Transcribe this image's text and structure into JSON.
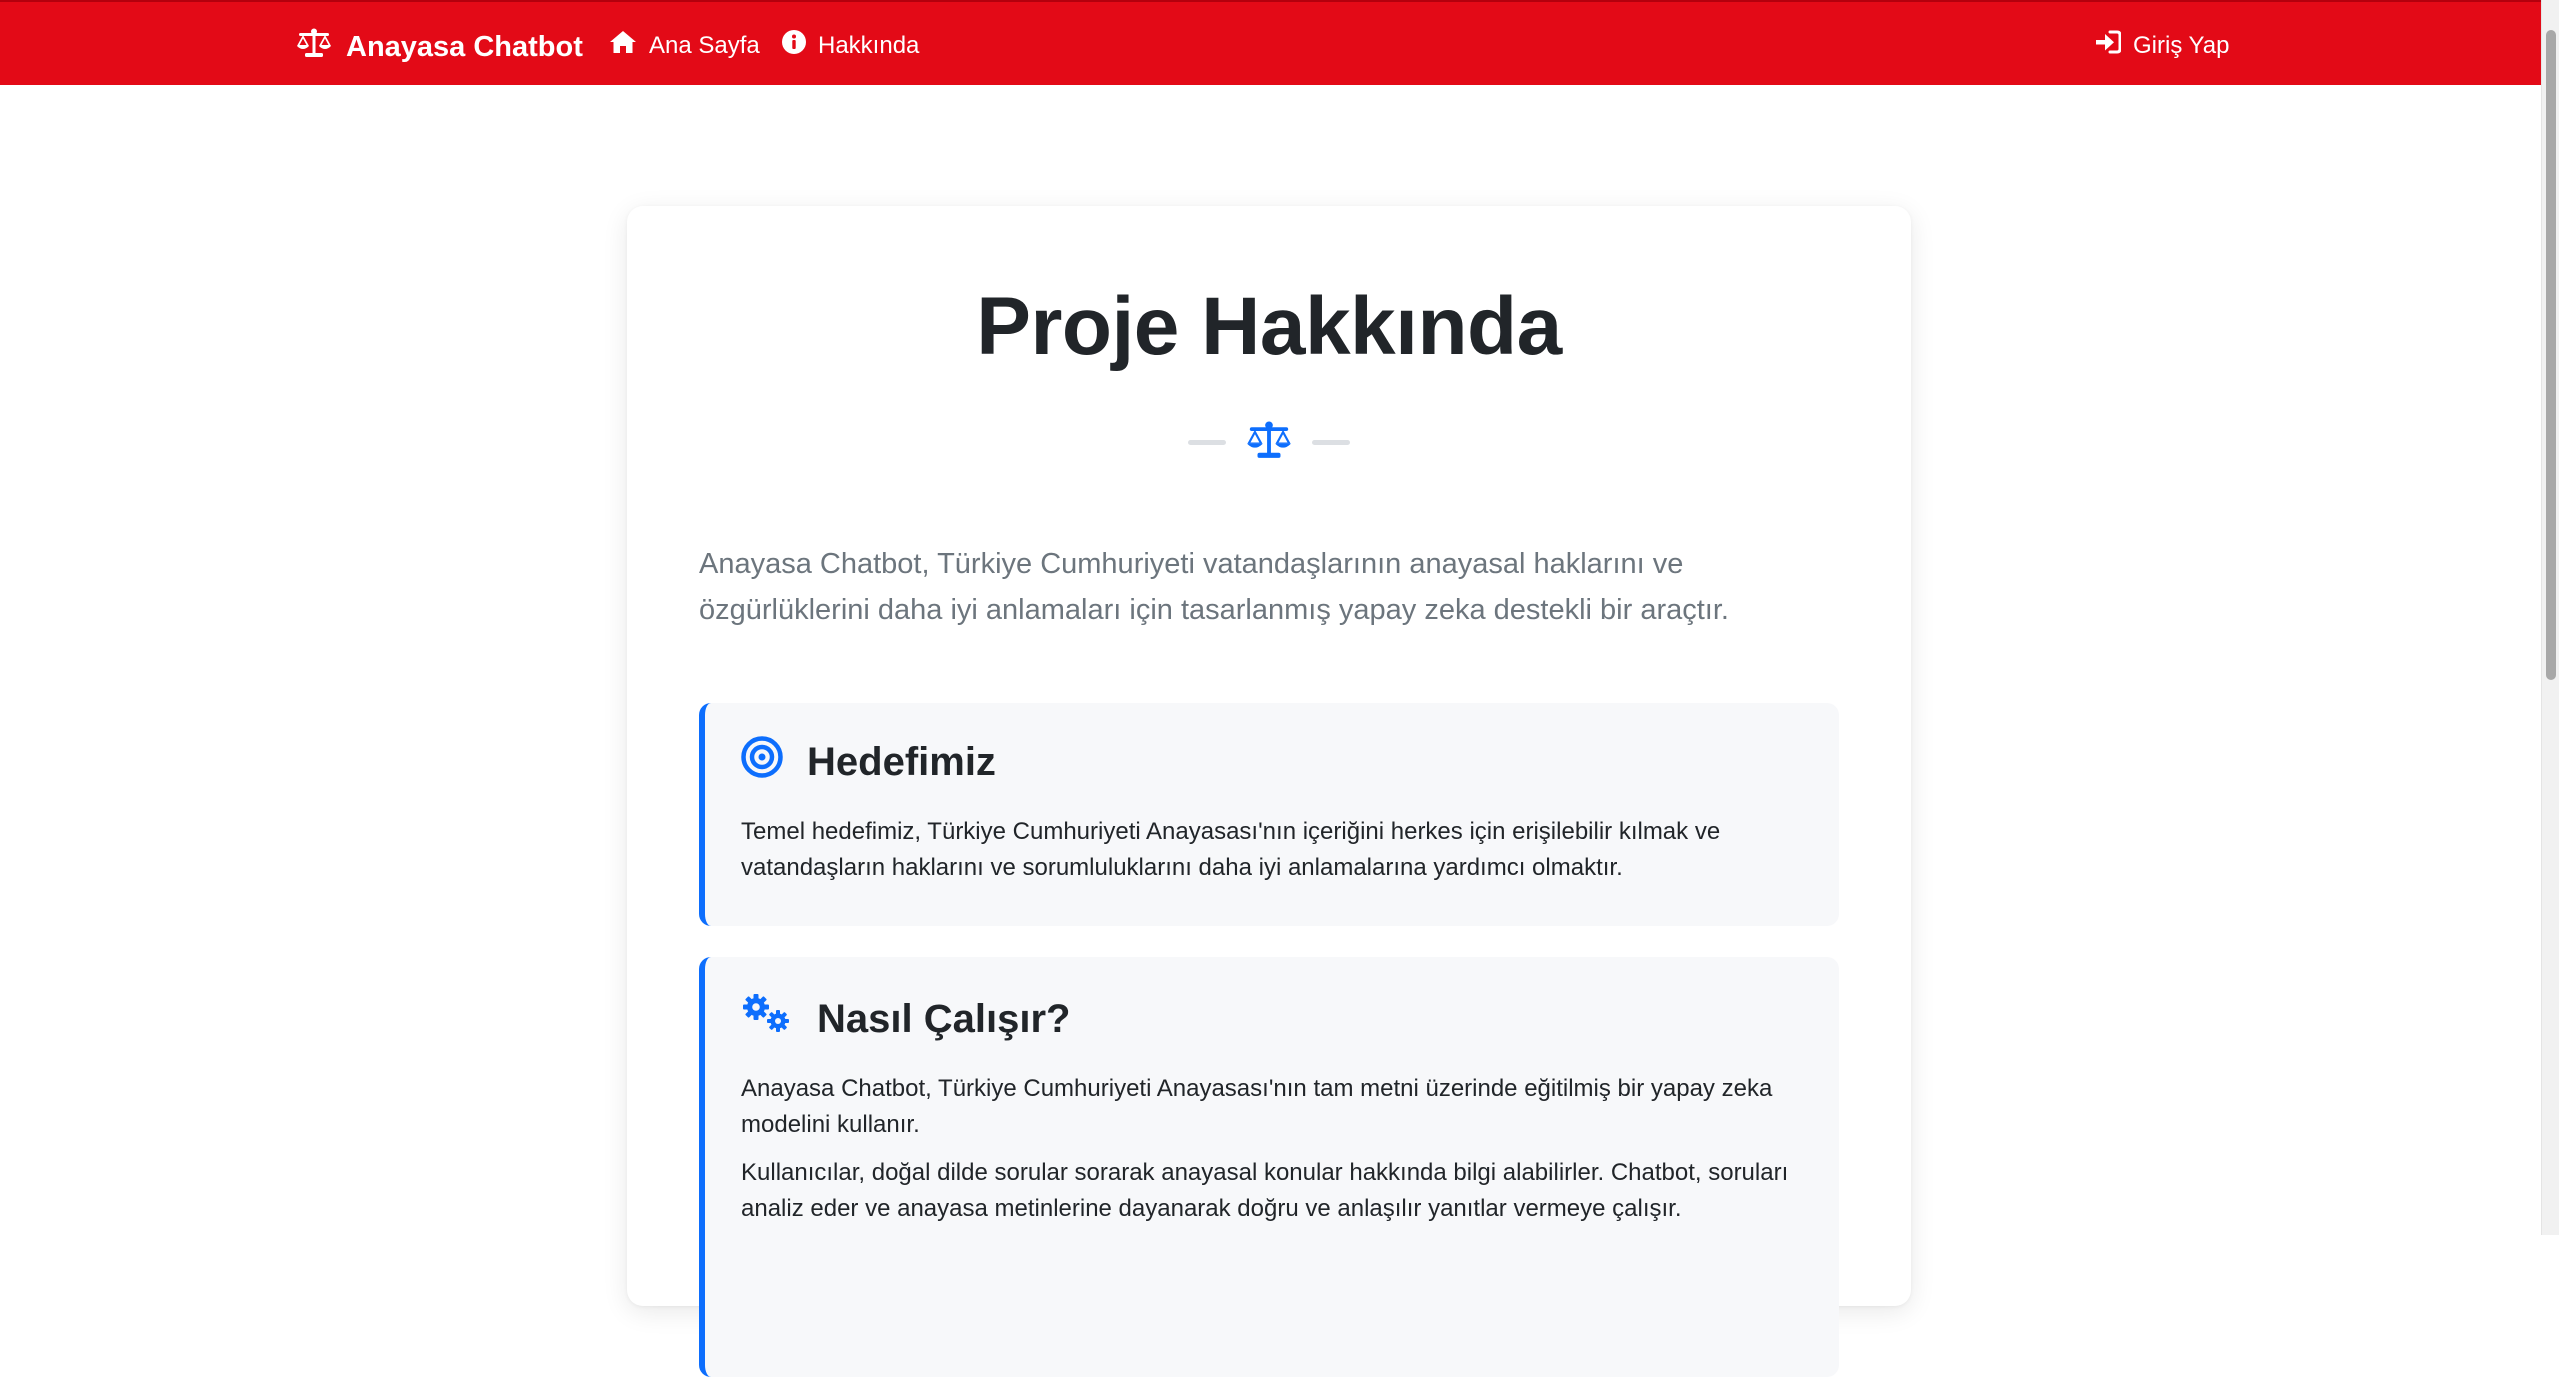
{
  "navbar": {
    "brand": "Anayasa Chatbot",
    "links": [
      {
        "label": "Ana Sayfa",
        "icon": "home-icon"
      },
      {
        "label": "Hakkında",
        "icon": "info-circle-icon"
      }
    ],
    "login": {
      "label": "Giriş Yap",
      "icon": "sign-in-icon"
    },
    "brand_color": "#e30a17"
  },
  "main": {
    "title": "Proje Hakkında",
    "divider_icon": "balance-scale-icon",
    "lead": "Anayasa Chatbot, Türkiye Cumhuriyeti vatandaşlarının anayasal haklarını ve özgürlüklerini daha iyi anlamaları için tasarlanmış yapay zeka destekli bir araçtır.",
    "accent_color": "#0d6efd",
    "sections": [
      {
        "icon": "bullseye-icon",
        "title": "Hedefimiz",
        "paragraphs": [
          "Temel hedefimiz, Türkiye Cumhuriyeti Anayasası'nın içeriğini herkes için erişilebilir kılmak ve vatandaşların haklarını ve sorumluluklarını daha iyi anlamalarına yardımcı olmaktır."
        ]
      },
      {
        "icon": "cogs-icon",
        "title": "Nasıl Çalışır?",
        "paragraphs": [
          "Anayasa Chatbot, Türkiye Cumhuriyeti Anayasası'nın tam metni üzerinde eğitilmiş bir yapay zeka modelini kullanır.",
          "Kullanıcılar, doğal dilde sorular sorarak anayasal konular hakkında bilgi alabilirler. Chatbot, soruları analiz eder ve anayasa metinlerine dayanarak doğru ve anlaşılır yanıtlar vermeye çalışır."
        ]
      }
    ]
  }
}
